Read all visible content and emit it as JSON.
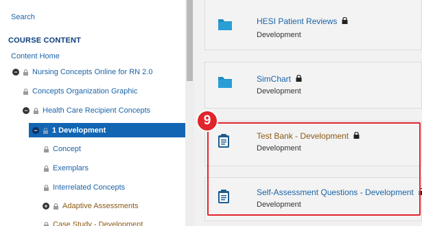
{
  "sidebar": {
    "search_link": "Search",
    "heading": "COURSE CONTENT",
    "home_link": "Content Home",
    "tree": [
      {
        "label": "Nursing Concepts Online for RN 2.0",
        "toggle": "−"
      },
      {
        "label": "Concepts Organization Graphic"
      },
      {
        "label": "Health Care Recipient Concepts",
        "toggle": "−"
      },
      {
        "label": "1 Development",
        "toggle": "−",
        "selected": true
      },
      {
        "label": "Concept"
      },
      {
        "label": "Exemplars"
      },
      {
        "label": "Interrelated Concepts"
      },
      {
        "label": "Adaptive Assessments",
        "toggle": "+"
      },
      {
        "label": "Case Study - Development"
      }
    ]
  },
  "main": {
    "cards": [
      {
        "title": "HESI Patient Reviews",
        "subtitle": "Development",
        "icon": "folder-icon"
      },
      {
        "title": "SimChart",
        "subtitle": "Development",
        "icon": "folder-icon"
      },
      {
        "title": "Test Bank - Development",
        "subtitle": "Development",
        "icon": "clipboard-icon"
      },
      {
        "title": "Self-Assessment Questions - Development",
        "subtitle": "Development",
        "icon": "clipboard-icon"
      }
    ]
  },
  "annotation": {
    "step_number": "9"
  },
  "colors": {
    "link": "#1a63a8",
    "selected_bg": "#1265b3",
    "visited_link": "#8b5a14",
    "highlight": "#e2242b",
    "folder": "#1f8fc4"
  }
}
